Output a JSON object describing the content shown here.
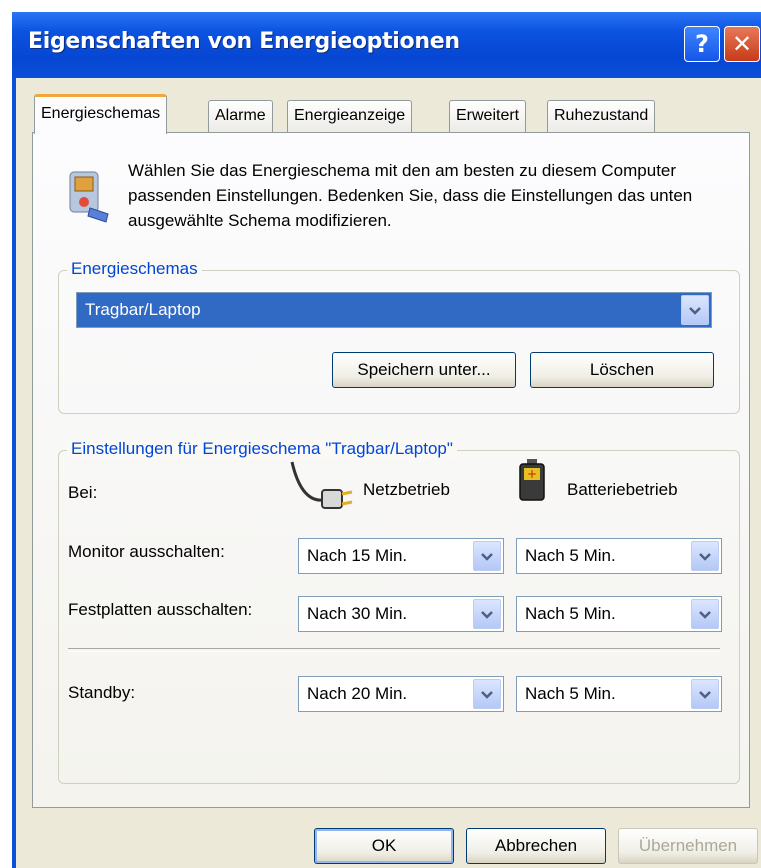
{
  "window": {
    "title": "Eigenschaften von Energieoptionen",
    "help_glyph": "?",
    "close_glyph": "✕"
  },
  "tabs": [
    {
      "label": "Energieschemas",
      "active": true
    },
    {
      "label": "Alarme"
    },
    {
      "label": "Energieanzeige"
    },
    {
      "label": "Erweitert"
    },
    {
      "label": "Ruhezustand"
    }
  ],
  "intro": {
    "text": "Wählen Sie das Energieschema mit den am besten zu diesem Computer passenden Einstellungen. Bedenken Sie, dass die Einstellungen das unten ausgewählte Schema modifizieren.",
    "icon": "power-options-icon"
  },
  "schemes": {
    "legend": "Energieschemas",
    "selected": "Tragbar/Laptop",
    "save_as_label": "Speichern unter...",
    "delete_label": "Löschen"
  },
  "settings": {
    "legend": "Einstellungen für Energieschema \"Tragbar/Laptop\"",
    "bei_label": "Bei:",
    "ac_label": "Netzbetrieb",
    "battery_label": "Batteriebetrieb",
    "monitor": {
      "label": "Monitor ausschalten:",
      "ac": "Nach 15 Min.",
      "battery": "Nach 5 Min."
    },
    "disks": {
      "label": "Festplatten ausschalten:",
      "ac": "Nach 30 Min.",
      "battery": "Nach 5 Min."
    },
    "standby": {
      "label": "Standby:",
      "ac": "Nach 20 Min.",
      "battery": "Nach 5 Min."
    }
  },
  "footer": {
    "ok_label": "OK",
    "cancel_label": "Abbrechen",
    "apply_label": "Übernehmen"
  },
  "colors": {
    "titlebar": "#0a4fd8",
    "legend_text": "#0046d5",
    "selection": "#316ac5",
    "tab_highlight": "#f2a73a"
  }
}
